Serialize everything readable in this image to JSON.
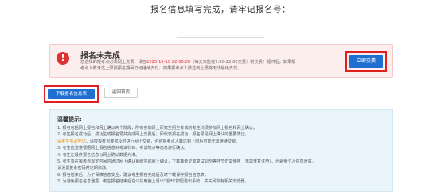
{
  "header": {
    "title": "报名信息填写完成，请牢记报名号："
  },
  "status": {
    "title": "报名未完成",
    "desc_part1": "您选择的报考点必须网上交费，请在",
    "deadline": "2025-10-10 22:00:00",
    "desc_part2": "（每天只能在9:00-22:00交费）前交费！超时后，如果报",
    "desc_line2": "考点人数未达上限则报名期间仍可继续支付，如果报考点人数达到上限将无法继续支付。",
    "pay_button": "立即交费"
  },
  "actions": {
    "download": "下载报名信息表",
    "back": "返回首页"
  },
  "tips": {
    "title": "温馨提示:",
    "items": [
      {
        "pre": "1. 报名包括网上报名和网上确认两个阶段，所有参加硕士研究生招生考试的考生均须参加网上报名和网上确认。",
        "hl": "",
        "post": ""
      },
      {
        "pre": "2. 考生报名成功后，",
        "hl": "",
        "post": "成功生成报名号并完成网上交费后，即代表报名成功，报名号是网上确认的重要凭证，"
      },
      {
        "pre": "",
        "hl": "请考生务必牢记",
        "post": "。请按报考点要求及时进行网上交费，否则报考点人数达到上限后可能无法继续交费。"
      },
      {
        "pre": "3. 考生应注意根据网上报名信息对考试科目、考试地点等信息进行确认。",
        "hl": "",
        "post": ""
      },
      {
        "pre": "4. 考生在最终报名信息以网上确认数据为准。",
        "hl": "",
        "post": ""
      },
      {
        "pre": "5. 考生须在报考点规定时间内通过网上确认系统完成网上确认，下载准考证或复试调剂等环节仍需使用（无需重复注册），为避免个人信息泄露，",
        "hl": "",
        "post": ""
      },
      {
        "pre": "请设置复杂密码并定期修改。",
        "hl": "",
        "post": ""
      },
      {
        "pre": "6. 报名结束后，为了保障信息安全，建议考生报名完成后及时下载保存报名信息表。",
        "hl": "",
        "post": ""
      },
      {
        "pre": "7. 为避免报名信息泄露，考生报名结束后在公共电脑上退出\"退出\"按钮退出系统，并关闭所有相关浏览器。",
        "hl": "",
        "post": ""
      }
    ]
  },
  "colors": {
    "primary": "#1f6fd1",
    "danger": "#e03131",
    "highlight": "#e02020",
    "tips_bg": "#eaf4fb",
    "warning_bg": "#fdeeee"
  },
  "icons": {
    "warning": "exclamation-circle-icon"
  }
}
